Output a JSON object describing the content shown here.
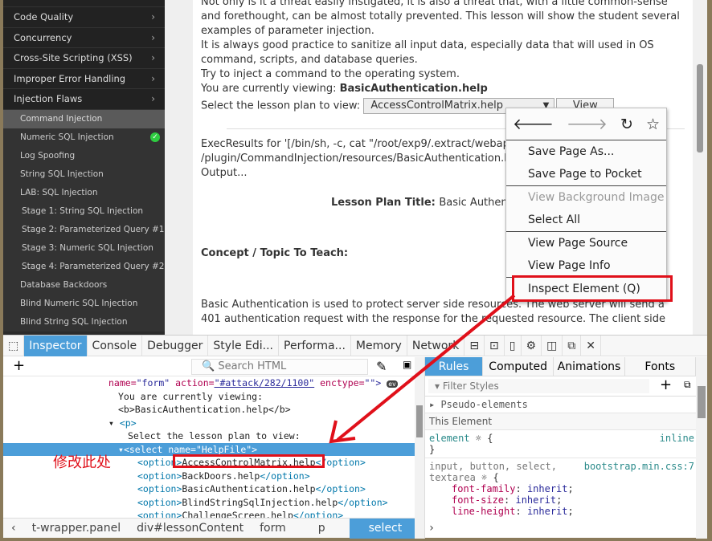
{
  "sidebar": {
    "categories": [
      {
        "label": "Code Quality"
      },
      {
        "label": "Concurrency"
      },
      {
        "label": "Cross-Site Scripting (XSS)"
      },
      {
        "label": "Improper Error Handling"
      },
      {
        "label": "Injection Flaws"
      }
    ],
    "lessons": [
      {
        "label": "Command Injection",
        "active": true
      },
      {
        "label": "Numeric SQL Injection",
        "completed": true
      },
      {
        "label": "Log Spoofing"
      },
      {
        "label": "String SQL Injection"
      },
      {
        "label": "LAB: SQL Injection"
      },
      {
        "label": "Stage 1: String SQL Injection"
      },
      {
        "label": "Stage 2: Parameterized Query #1"
      },
      {
        "label": "Stage 3: Numeric SQL Injection"
      },
      {
        "label": "Stage 4: Parameterized Query #2"
      },
      {
        "label": "Database Backdoors"
      },
      {
        "label": "Blind Numeric SQL Injection"
      },
      {
        "label": "Blind String SQL Injection"
      }
    ]
  },
  "content": {
    "para1": "Not only is it a threat easily instigated, it is also a threat that, with a little common-sense and forethought, can be almost totally prevented. This lesson will show the student several examples of parameter injection.",
    "para2": "It is always good practice to sanitize all input data, especially data that will used in OS command, scripts, and database queries.",
    "para3": "Try to inject a command to the operating system.",
    "viewing_label": "You are currently viewing: ",
    "viewing_value": "BasicAuthentication.help",
    "select_label": "Select the lesson plan to view: ",
    "select_value": "AccessControlMatrix.help",
    "view_button": "View",
    "exec1": "ExecResults for '[/bin/sh, -c, cat \"/root/exp9/.extract/webapp",
    "exec2": "/plugin/CommandInjection/resources/BasicAuthentication.ht",
    "exec3": "Output...",
    "plan_title_label": "Lesson Plan Title: ",
    "plan_title_value": "Basic Authent",
    "concept": "Concept / Topic To Teach:",
    "basic_auth": "Basic Authentication is used to protect server side resources. The web server will send a 401 authentication request with the response for the requested resource. The client side"
  },
  "context_menu": {
    "nav": [
      "back-icon",
      "forward-icon",
      "reload-icon",
      "bookmark-star-icon"
    ],
    "items": [
      {
        "label": "Save Page As..."
      },
      {
        "label": "Save Page to Pocket"
      },
      {
        "label": "View Background Image",
        "disabled": true
      },
      {
        "label": "Select All"
      },
      {
        "label": "View Page Source"
      },
      {
        "label": "View Page Info"
      },
      {
        "label": "Inspect Element (Q)"
      }
    ]
  },
  "devtools": {
    "tabs": [
      "Inspector",
      "Console",
      "Debugger",
      "Style Edi...",
      "Performa...",
      "Memory",
      "Network"
    ],
    "active_tab": "Inspector",
    "search_placeholder": "Search HTML",
    "markup": {
      "l1a": "name=",
      "l1b": "\"form\"",
      "l1c": " action=",
      "l1d": "\"#attack/282/1100\"",
      "l1e": " enctype=",
      "l1f": "\"\">",
      "ev": "ev",
      "l2": "You are currently viewing:",
      "l3": "<b>BasicAuthentication.help</b>",
      "l4": "<p>",
      "l5": "Select the lesson plan to view:",
      "l6": "<select name=\"HelpFile\">",
      "options": [
        "AccessControlMatrix.help",
        "BackDoors.help",
        "BasicAuthentication.help",
        "BlindStringSqlInjection.help",
        "ChallengeScreen.help"
      ],
      "option_open": "<option>",
      "option_close": "</option>"
    },
    "annotation": "修改此处",
    "breadcrumbs": [
      "t-wrapper.panel",
      "div#lessonContent",
      "form",
      "p",
      "select"
    ],
    "rules_tabs": [
      "Rules",
      "Computed",
      "Animations",
      "Fonts"
    ],
    "filter_placeholder": "Filter Styles",
    "pseudo": "Pseudo-elements",
    "this_element": "This Element",
    "element_sel": "element",
    "inline": "inline",
    "rule2_sel": "input, button, select,",
    "rule2_sel2": "textarea",
    "rule2_src": "bootstrap.min.css:7",
    "props": [
      {
        "name": "font-family",
        "value": "inherit"
      },
      {
        "name": "font-size",
        "value": "inherit"
      },
      {
        "name": "line-height",
        "value": "inherit"
      }
    ]
  },
  "colors": {
    "accent": "#4c9ed9",
    "highlight_red": "#e0101a",
    "sidebar_bg": "#222222"
  }
}
